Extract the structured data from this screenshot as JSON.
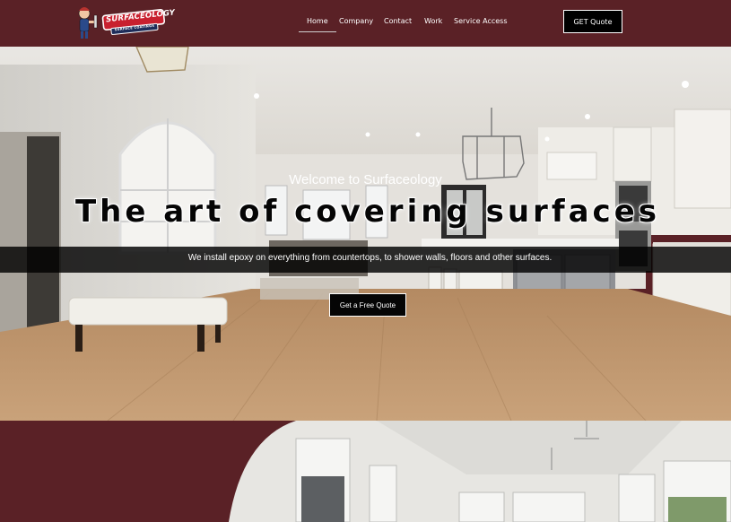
{
  "brand": {
    "name": "SURFACEOLOGY",
    "tagline": "SURFACE COATINGS",
    "color_primary": "#5a2126",
    "color_logo_red": "#c8202f"
  },
  "nav": {
    "items": [
      {
        "label": "Home",
        "active": true
      },
      {
        "label": "Company",
        "active": false
      },
      {
        "label": "Contact",
        "active": false
      },
      {
        "label": "Work",
        "active": false
      },
      {
        "label": "Service Access",
        "active": false
      }
    ],
    "cta_label": "GET Quote"
  },
  "hero": {
    "welcome": "Welcome to Surfaceology",
    "title": "The art of covering surfaces",
    "subtitle": "We install epoxy on everything from countertops, to shower walls, floors and other surfaces.",
    "button_label": "Get a Free Quote"
  }
}
